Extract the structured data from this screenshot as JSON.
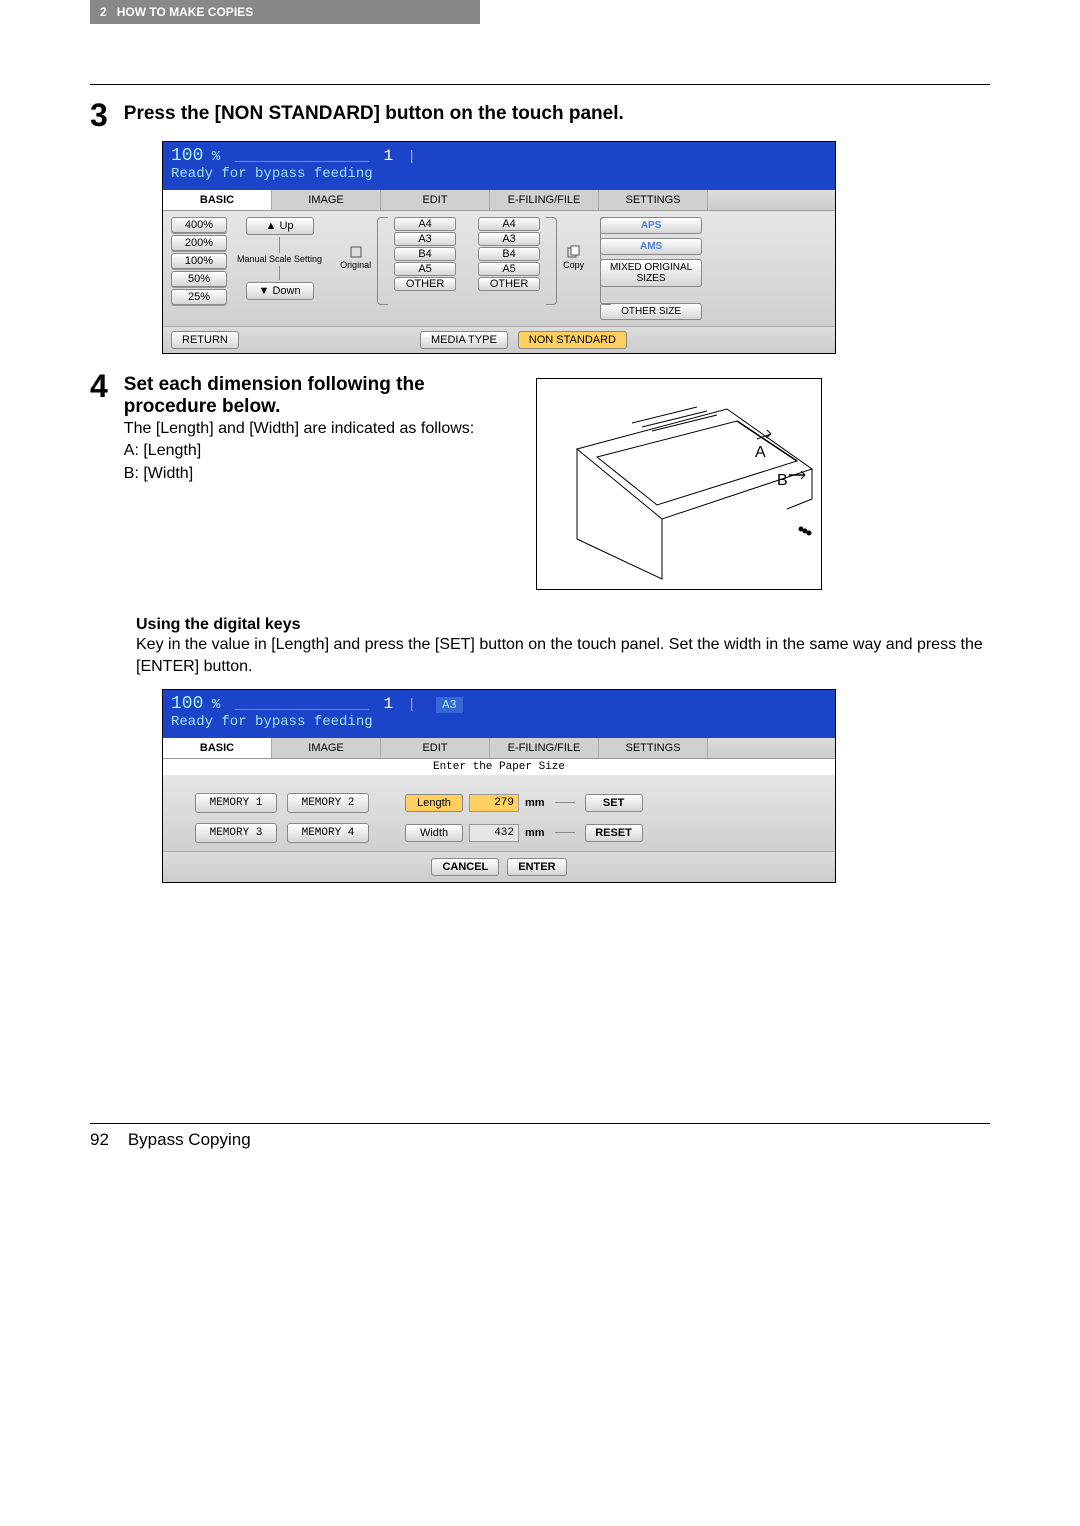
{
  "header": {
    "chapter_num": "2",
    "chapter_title": "HOW TO MAKE COPIES"
  },
  "step3": {
    "number": "3",
    "title": "Press the [NON STANDARD] button on the touch panel."
  },
  "screenshot1": {
    "zoom": "100",
    "pct": "%",
    "count": "1",
    "status": "Ready for bypass feeding",
    "tabs": [
      "BASIC",
      "IMAGE",
      "EDIT",
      "E-FILING/FILE",
      "SETTINGS"
    ],
    "zooms": [
      "400%",
      "200%",
      "100%",
      "50%",
      "25%"
    ],
    "up": "Up",
    "down": "Down",
    "manual": "Manual Scale Setting",
    "original": "Original",
    "copy": "Copy",
    "orig_sizes": [
      "A4",
      "A3",
      "B4",
      "A5",
      "OTHER"
    ],
    "copy_sizes": [
      "A4",
      "A3",
      "B4",
      "A5",
      "OTHER"
    ],
    "aps": "APS",
    "ams": "AMS",
    "mixed": "MIXED ORIGINAL SIZES",
    "other_size": "OTHER SIZE",
    "return_btn": "RETURN",
    "media_type": "MEDIA TYPE",
    "non_standard": "NON STANDARD"
  },
  "step4": {
    "number": "4",
    "title": "Set each dimension following the procedure below.",
    "desc1": "The [Length] and [Width] are indicated as follows:",
    "desc2": "A: [Length]",
    "desc3": "B: [Width]",
    "diagram_a": "A",
    "diagram_b": "B"
  },
  "digital_keys": {
    "heading": "Using the digital keys",
    "desc": "Key in the value in [Length] and press the [SET] button on the touch panel. Set the width in the same way and press the [ENTER] button."
  },
  "screenshot2": {
    "zoom": "100",
    "pct": "%",
    "count": "1",
    "size": "A3",
    "status": "Ready for bypass feeding",
    "tabs": [
      "BASIC",
      "IMAGE",
      "EDIT",
      "E-FILING/FILE",
      "SETTINGS"
    ],
    "enter_lbl": "Enter the Paper Size",
    "mem1": "MEMORY 1",
    "mem2": "MEMORY 2",
    "mem3": "MEMORY 3",
    "mem4": "MEMORY 4",
    "length_lbl": "Length",
    "length_val": "279",
    "width_lbl": "Width",
    "width_val": "432",
    "mm": "mm",
    "set": "SET",
    "reset": "RESET",
    "cancel": "CANCEL",
    "enter": "ENTER"
  },
  "footer": {
    "page_num": "92",
    "section": "Bypass Copying"
  }
}
